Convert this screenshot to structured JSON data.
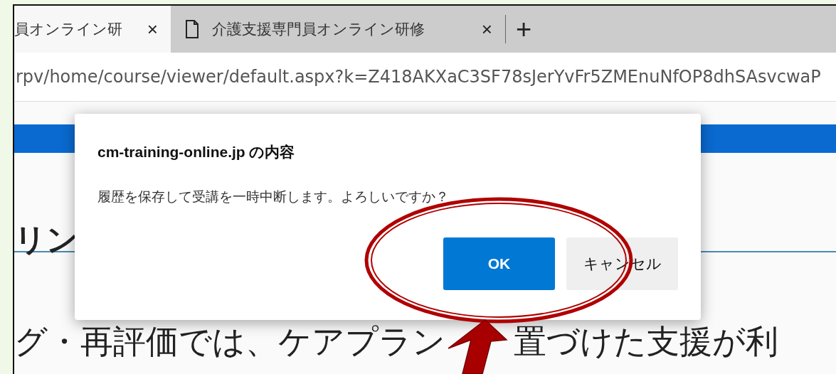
{
  "tabs": [
    {
      "label": "員オンライン研",
      "close": "×",
      "selected": true
    },
    {
      "label": "介護支援専門員オンライン研修",
      "close": "×",
      "selected": false
    }
  ],
  "new_tab": "+",
  "address_bar": {
    "value": "rpv/home/course/viewer/default.aspx?k=Z418AKXaC3SF78sJerYvFr5ZMEnuNfOP8dhSAsvcwaP"
  },
  "page": {
    "heading": "リン",
    "body": [
      "グ・再評価では、ケアプラン",
      "置づけた支援が利"
    ]
  },
  "dialog": {
    "title": "cm-training-online.jp の内容",
    "message": "履歴を保存して受講を一時中断します。よろしいですか？",
    "buttons": [
      {
        "label": "OK",
        "kind": "primary"
      },
      {
        "label": "キャンセル",
        "kind": "secondary"
      }
    ]
  }
}
